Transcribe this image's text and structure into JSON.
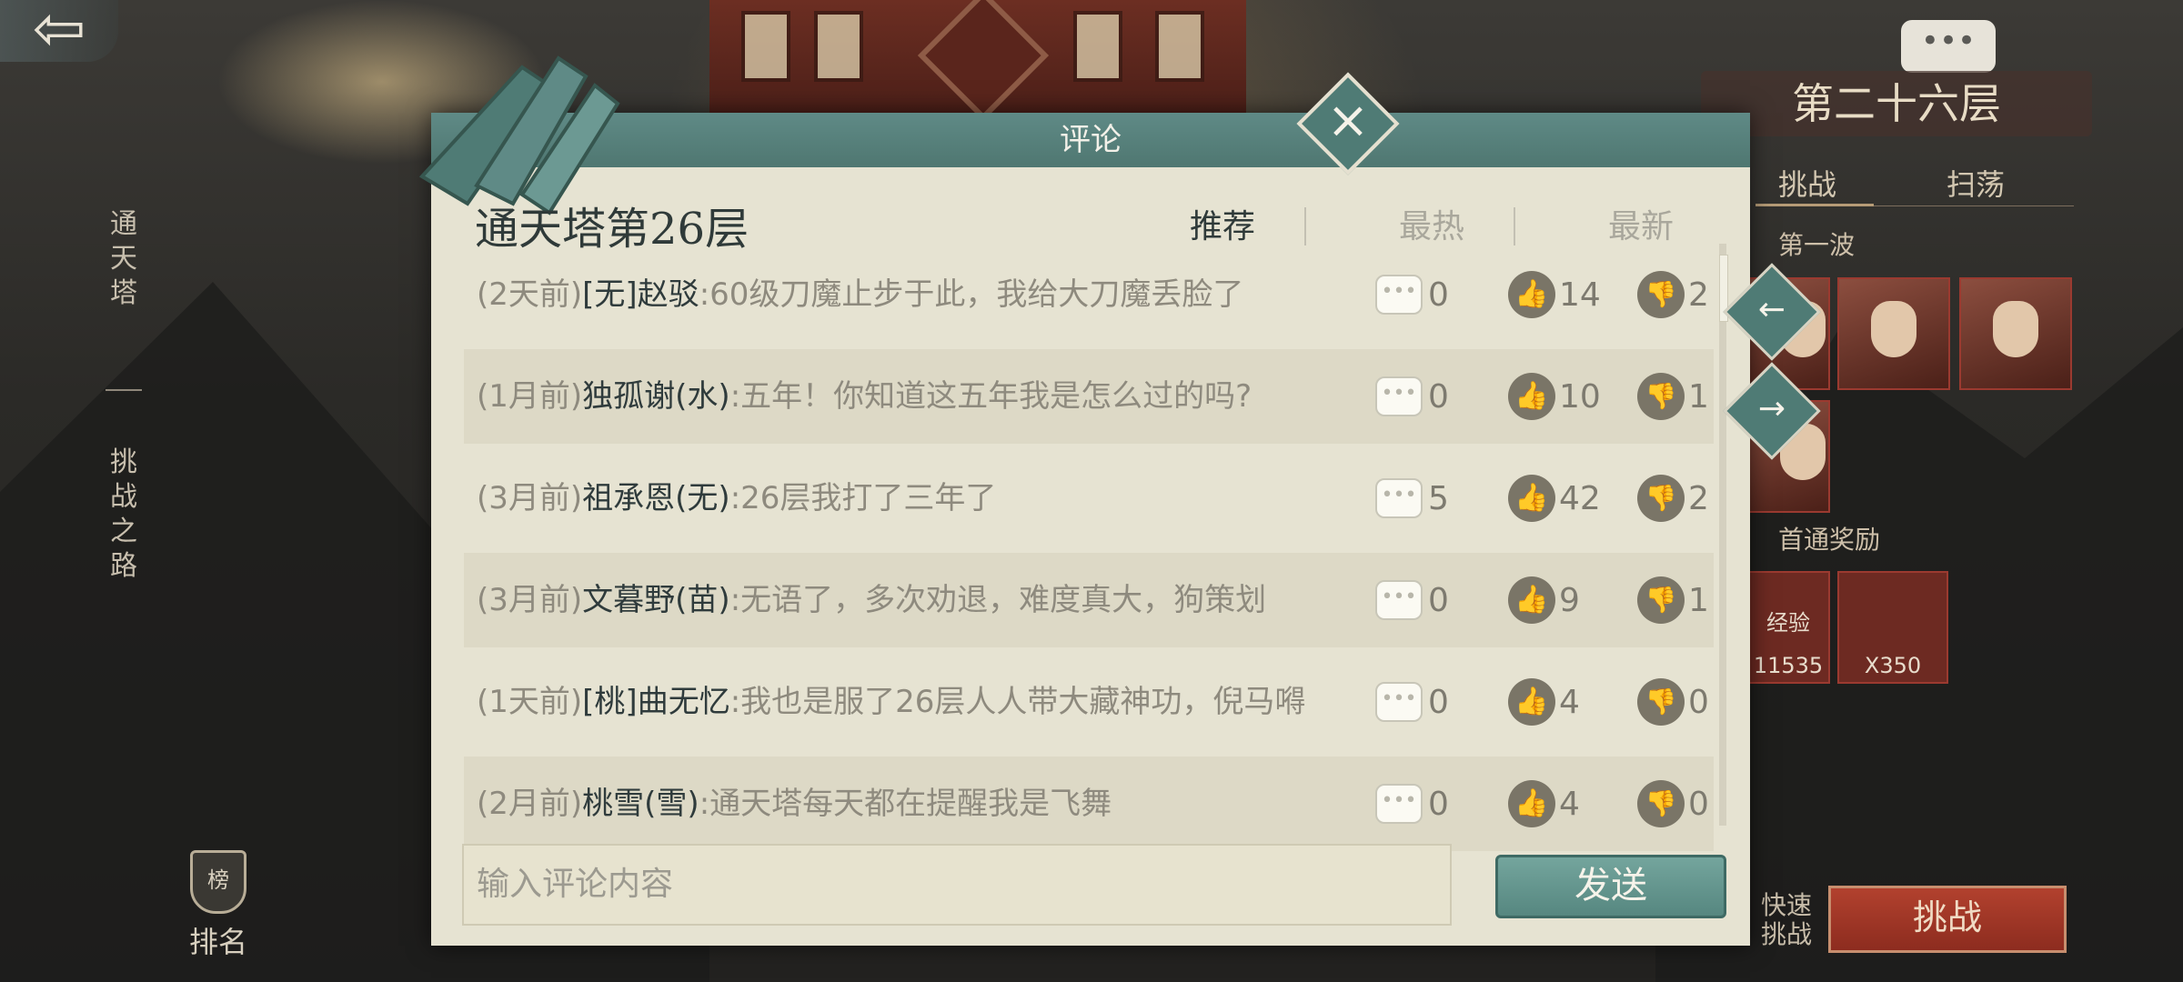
{
  "background": {
    "left_nav": {
      "item1": "通天塔",
      "item2": "挑战之路",
      "rank_label": "排名",
      "rank_icon_text": "榜"
    },
    "floor_title": "第二十六层",
    "right_tabs": [
      "挑战",
      "扫荡"
    ],
    "first_wave": "第一波",
    "rewards_title": "首通奖励",
    "rewards": [
      {
        "text": "经验",
        "count": "11535"
      },
      {
        "text": "",
        "count": "X350"
      }
    ],
    "quick_challenge": "快速挑战",
    "challenge": "挑战"
  },
  "modal": {
    "header": "评论",
    "title": "通天塔第26层",
    "tabs": [
      {
        "label": "推荐",
        "active": true
      },
      {
        "label": "最热",
        "active": false
      },
      {
        "label": "最新",
        "active": false
      }
    ],
    "comments": [
      {
        "time": "(2天前)",
        "user": "[无]赵驳",
        "text": ":60级刀魔止步于此，我给大刀魔丢脸了",
        "comments": "0",
        "likes": "14",
        "dislikes": "2"
      },
      {
        "time": "(1月前)",
        "user": "独孤谢(水)",
        "text": ":五年！你知道这五年我是怎么过的吗?",
        "comments": "0",
        "likes": "10",
        "dislikes": "1"
      },
      {
        "time": "(3月前)",
        "user": "祖承恩(无)",
        "text": ":26层我打了三年了",
        "comments": "5",
        "likes": "42",
        "dislikes": "2"
      },
      {
        "time": "(3月前)",
        "user": "文暮野(苗)",
        "text": ":无语了，多次劝退，难度真大，狗策划",
        "comments": "0",
        "likes": "9",
        "dislikes": "1"
      },
      {
        "time": "(1天前)",
        "user": "[桃]曲无忆",
        "text": ":我也是服了26层人人带大藏神功，倪马嘚",
        "comments": "0",
        "likes": "4",
        "dislikes": "0"
      },
      {
        "time": "(2月前)",
        "user": "桃雪(雪)",
        "text": ":通天塔每天都在提醒我是飞舞",
        "comments": "0",
        "likes": "4",
        "dislikes": "0"
      }
    ],
    "input_placeholder": "输入评论内容",
    "send_label": "发送",
    "icons": {
      "close": "close-icon",
      "prev": "arrow-left-icon",
      "next": "arrow-right-icon",
      "comment": "comment-bubble-icon",
      "like": "thumbs-up-icon",
      "dislike": "thumbs-down-icon"
    }
  }
}
